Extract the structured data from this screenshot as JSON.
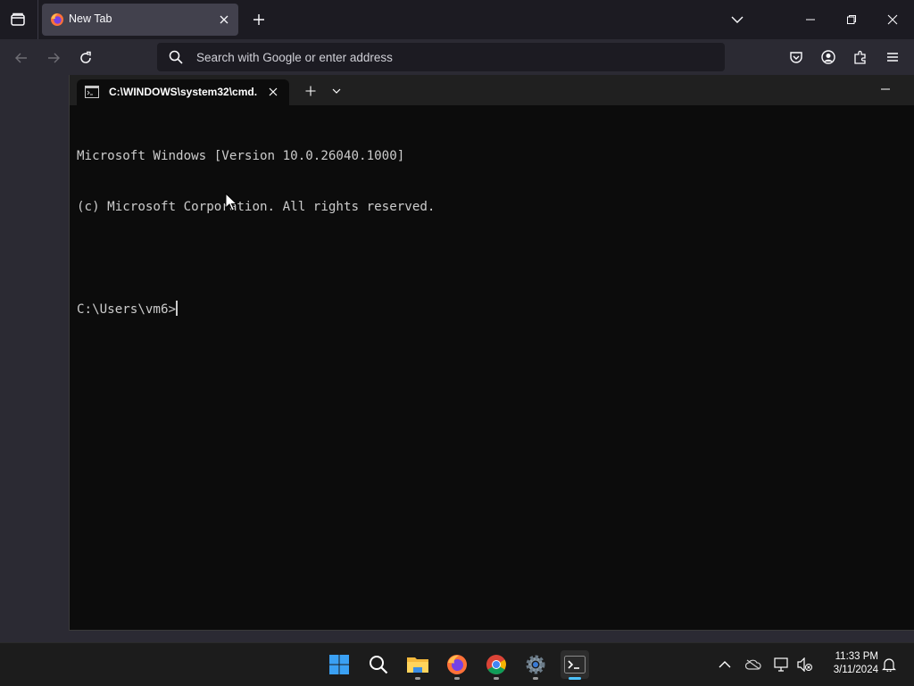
{
  "browser": {
    "tabs": [
      {
        "title": "New Tab",
        "favicon": "firefox-icon"
      }
    ],
    "urlbar": {
      "placeholder": "Search with Google or enter address",
      "value": ""
    },
    "toolbar_icons": [
      "pocket-icon",
      "account-icon",
      "extensions-icon",
      "menu-icon"
    ]
  },
  "terminal": {
    "tab_title": "C:\\WINDOWS\\system32\\cmd.",
    "lines": [
      "Microsoft Windows [Version 10.0.26040.1000]",
      "(c) Microsoft Corporation. All rights reserved.",
      "",
      "C:\\Users\\vm6>"
    ]
  },
  "taskbar": {
    "apps": [
      "start-icon",
      "search-icon",
      "file-explorer-icon",
      "firefox-icon",
      "chrome-icon",
      "settings-icon",
      "terminal-icon"
    ],
    "active_app": "terminal-icon",
    "tray_icons": [
      "chevron-up-icon",
      "onedrive-icon",
      "network-icon",
      "volume-muted-icon",
      "notification-bell-icon"
    ],
    "clock": {
      "time": "11:33 PM",
      "date": "3/11/2024"
    }
  },
  "colors": {
    "browser_bg": "#1c1b22",
    "browser_toolbar": "#2b2a33",
    "terminal_bg": "#0c0c0c",
    "terminal_text": "#cccccc",
    "accent": "#4cc2ff"
  }
}
